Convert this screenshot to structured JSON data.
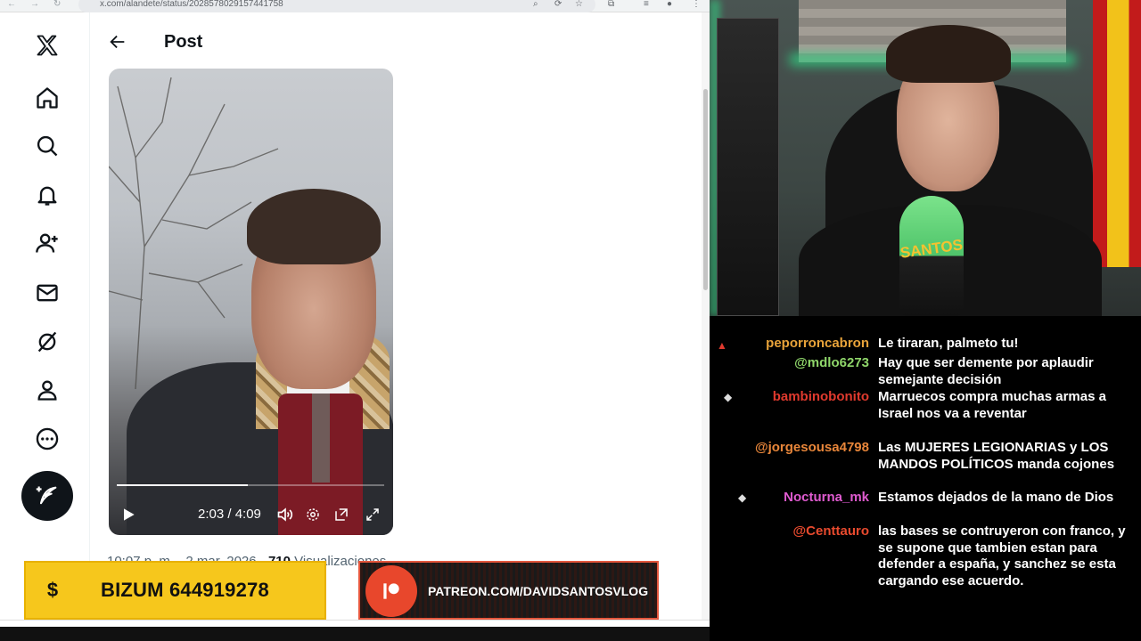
{
  "browser": {
    "url": "x.com/alandete/status/2028578029157441758",
    "nav_back": "←",
    "nav_forward": "→",
    "reload": "↻"
  },
  "post": {
    "title": "Post",
    "video": {
      "time": "2:03 / 4:09",
      "progress": 0.49
    },
    "meta": {
      "prefix": "10:07 p. m. · 2 mar. 2026 · ",
      "views": "710",
      "views_label": " Visualizaciones"
    }
  },
  "sidebar": {
    "items": [
      "x-logo",
      "home",
      "explore",
      "notifications",
      "follow",
      "messages",
      "grok",
      "profile",
      "more"
    ],
    "post_button": "Post"
  },
  "overlays": {
    "bizum_icon": "$",
    "bizum_text": "BIZUM 644919278",
    "patreon_text": "PATREON.COM/DAVIDSANTOSVLOG"
  },
  "webcam": {
    "mic_label": "SANTOS"
  },
  "chat": {
    "messages": [
      {
        "user": "peporroncabron",
        "color": "#e8a33a",
        "text": "Le tiraran, palmeto tu!"
      },
      {
        "user": "@mdlo6273",
        "color": "#8fd66a",
        "text": "Hay que ser demente por aplaudir semejante decisión"
      },
      {
        "user": "bambinobonito",
        "color": "#e03a2e",
        "text": "Marruecos compra muchas armas a Israel nos va a reventar"
      },
      {
        "user": "@jorgesousa4798",
        "color": "#e8863a",
        "text": "Las MUJERES LEGIONARIAS y LOS MANDOS POLÍTICOS manda cojones"
      },
      {
        "user": "Nocturna_mk",
        "color": "#e05bd0",
        "text": "Estamos dejados de la mano de Dios"
      },
      {
        "user": "@Centtauro",
        "color": "#e84a2e",
        "text": "las bases se contruyeron con franco, y se supone que tambien estan para defender a españa, y sanchez se esta cargando ese acuerdo."
      }
    ]
  }
}
